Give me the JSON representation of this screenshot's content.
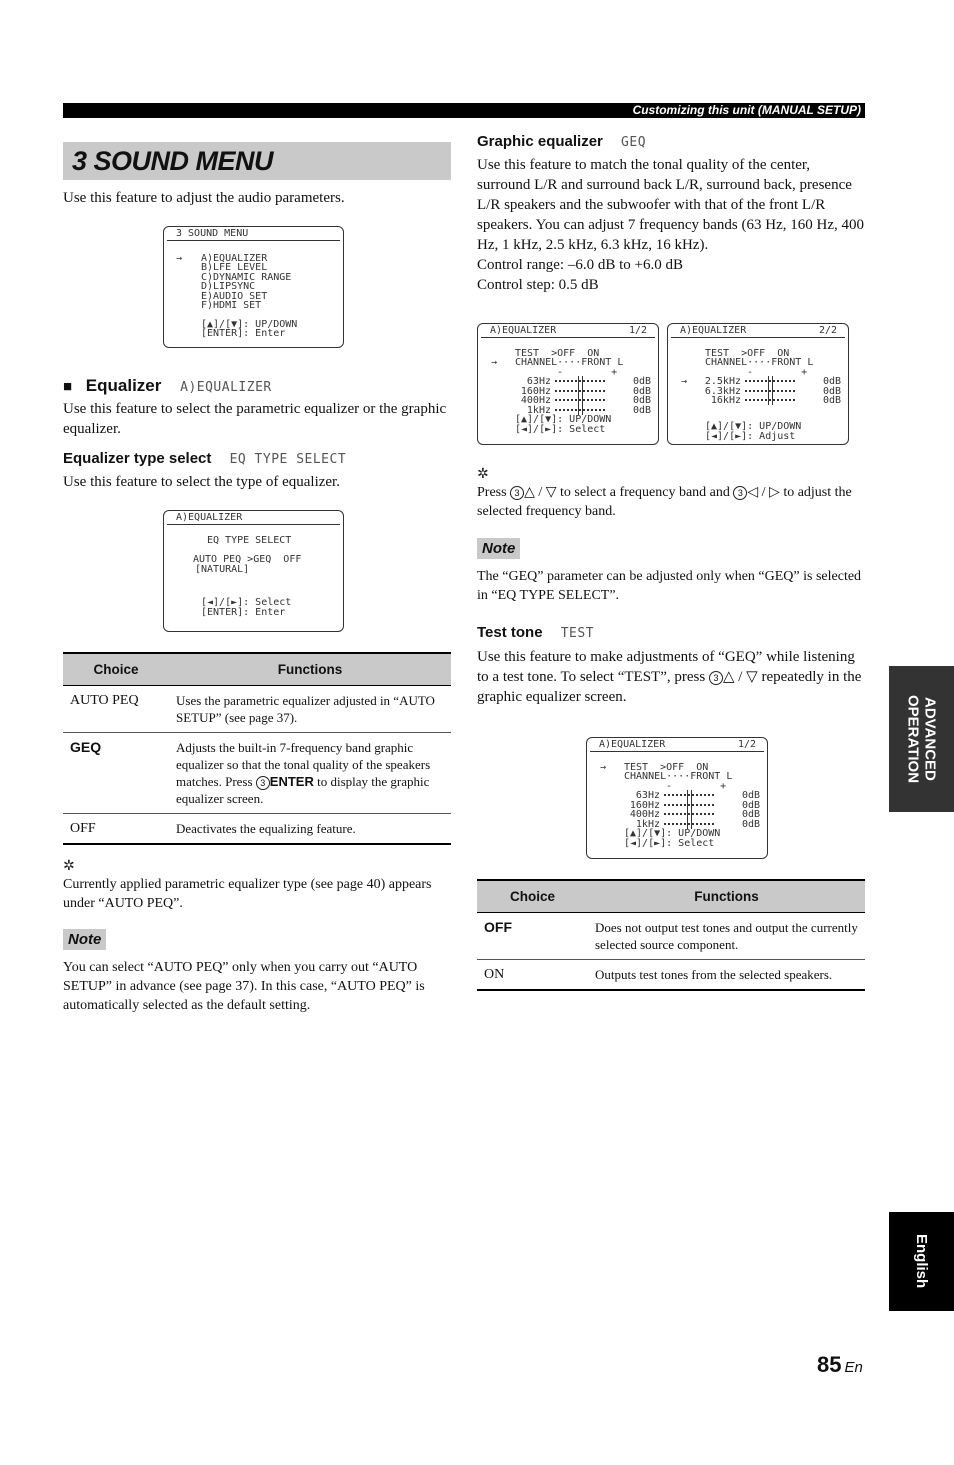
{
  "header": {
    "section": "Customizing this unit (MANUAL SETUP)"
  },
  "left": {
    "title": "3 SOUND MENU",
    "intro": "Use this feature to adjust the audio parameters.",
    "menu_osd": {
      "title": "3 SOUND MENU",
      "items": [
        "A)EQUALIZER",
        "B)LFE LEVEL",
        "C)DYNAMIC RANGE",
        "D)LIPSYNC",
        "E)AUDIO SET",
        "F)HDMI SET"
      ],
      "selected_index": 0,
      "cursor": "→",
      "hints": [
        "[▲]/[▼]: UP/DOWN",
        "[ENTER]: Enter"
      ]
    },
    "equalizer": {
      "bullet": "■",
      "heading": "Equalizer",
      "lcd": "A)EQUALIZER",
      "desc": "Use this feature to select the parametric equalizer or the graphic equalizer."
    },
    "eq_type": {
      "heading": "Equalizer type select",
      "lcd": "EQ TYPE SELECT",
      "desc": "Use this feature to select the type of equalizer.",
      "osd": {
        "title": "A)EQUALIZER",
        "subtitle": "EQ TYPE SELECT",
        "options_line": "AUTO PEQ >GEQ  OFF",
        "sub_line": "[NATURAL]",
        "hints": [
          "[◄]/[►]: Select",
          "[ENTER]: Enter"
        ]
      }
    },
    "table": {
      "headers": [
        "Choice",
        "Functions"
      ],
      "rows": [
        {
          "choice": "AUTO PEQ",
          "bold": false,
          "function": "Uses the parametric equalizer adjusted in “AUTO SETUP” (see page 37)."
        },
        {
          "choice": "GEQ",
          "bold": true,
          "function_pre": "Adjusts the built-in 7-frequency band graphic equalizer so that the tonal quality of the speakers matches. Press ",
          "function_key_num": "3",
          "function_key": "ENTER",
          "function_post": " to display the graphic equalizer screen."
        },
        {
          "choice": "OFF",
          "bold": false,
          "function": "Deactivates the equalizing feature."
        }
      ]
    },
    "tip": {
      "icon": "light-bulb",
      "text": "Currently applied parametric equalizer type (see page 40) appears under “AUTO PEQ”."
    },
    "note": {
      "label": "Note",
      "text": "You can select “AUTO PEQ” only when you carry out “AUTO SETUP” in advance (see page 37). In this case, “AUTO PEQ” is automatically selected as the default setting."
    }
  },
  "right": {
    "geq": {
      "heading": "Graphic equalizer",
      "lcd": "GEQ",
      "desc": "Use this feature to match the tonal quality of the center, surround L/R and surround back L/R, surround back, presence L/R speakers and the subwoofer with that of the front L/R speakers. You can adjust 7 frequency bands (63 Hz, 160 Hz, 400 Hz, 1 kHz, 2.5 kHz, 6.3 kHz, 16 kHz).",
      "range": "Control range: –6.0 dB to +6.0 dB",
      "step": "Control step: 0.5 dB"
    },
    "osd_page1": {
      "title": "A)EQUALIZER",
      "page": "1/2",
      "test_line": "TEST  >OFF  ON",
      "channel_line": "CHANNEL····FRONT L",
      "scale": "-        +",
      "cursor_on": "channel",
      "bands": [
        {
          "freq": "63Hz",
          "level": "0dB"
        },
        {
          "freq": "160Hz",
          "level": "0dB"
        },
        {
          "freq": "400Hz",
          "level": "0dB"
        },
        {
          "freq": "1kHz",
          "level": "0dB"
        }
      ],
      "hints": [
        "[▲]/[▼]: UP/DOWN",
        "[◄]/[►]: Select"
      ]
    },
    "osd_page2": {
      "title": "A)EQUALIZER",
      "page": "2/2",
      "test_line": "TEST  >OFF  ON",
      "channel_line": "CHANNEL····FRONT L",
      "scale": "-        +",
      "cursor_on": "band0",
      "bands": [
        {
          "freq": "2.5kHz",
          "level": "0dB"
        },
        {
          "freq": "6.3kHz",
          "level": "0dB"
        },
        {
          "freq": "16kHz",
          "level": "0dB"
        }
      ],
      "hints": [
        "[▲]/[▼]: UP/DOWN",
        "[◄]/[►]: Adjust"
      ]
    },
    "tip": {
      "icon": "light-bulb",
      "text_1": "Press ",
      "num": "3",
      "updown": "△ / ▽",
      "text_2": " to select a frequency band and ",
      "leftright": "◁ / ▷",
      "text_3": " to adjust the selected frequency band."
    },
    "note": {
      "label": "Note",
      "text": "The “GEQ” parameter can be adjusted only when “GEQ” is selected in “EQ TYPE SELECT”."
    },
    "test_tone": {
      "heading": "Test tone",
      "lcd": "TEST",
      "desc_1": "Use this feature to make adjustments of “GEQ” while listening to a test tone. To select “TEST”, press ",
      "num": "3",
      "updown": "△ / ▽",
      "desc_2": " repeatedly in the graphic equalizer screen."
    },
    "osd_test": {
      "title": "A)EQUALIZER",
      "page": "1/2",
      "test_line": "TEST  >OFF  ON",
      "channel_line": "CHANNEL····FRONT L",
      "scale": "-        +",
      "cursor_on": "test",
      "bands": [
        {
          "freq": "63Hz",
          "level": "0dB"
        },
        {
          "freq": "160Hz",
          "level": "0dB"
        },
        {
          "freq": "400Hz",
          "level": "0dB"
        },
        {
          "freq": "1kHz",
          "level": "0dB"
        }
      ],
      "hints": [
        "[▲]/[▼]: UP/DOWN",
        "[◄]/[►]: Select"
      ]
    },
    "table": {
      "headers": [
        "Choice",
        "Functions"
      ],
      "rows": [
        {
          "choice": "OFF",
          "bold": true,
          "function": "Does not output test tones and output the currently selected source component."
        },
        {
          "choice": "ON",
          "bold": false,
          "function": "Outputs test tones from the selected speakers."
        }
      ]
    }
  },
  "side_tabs": {
    "advanced": "ADVANCED OPERATION",
    "language": "English"
  },
  "footer": {
    "page": "85",
    "lang": "En"
  }
}
